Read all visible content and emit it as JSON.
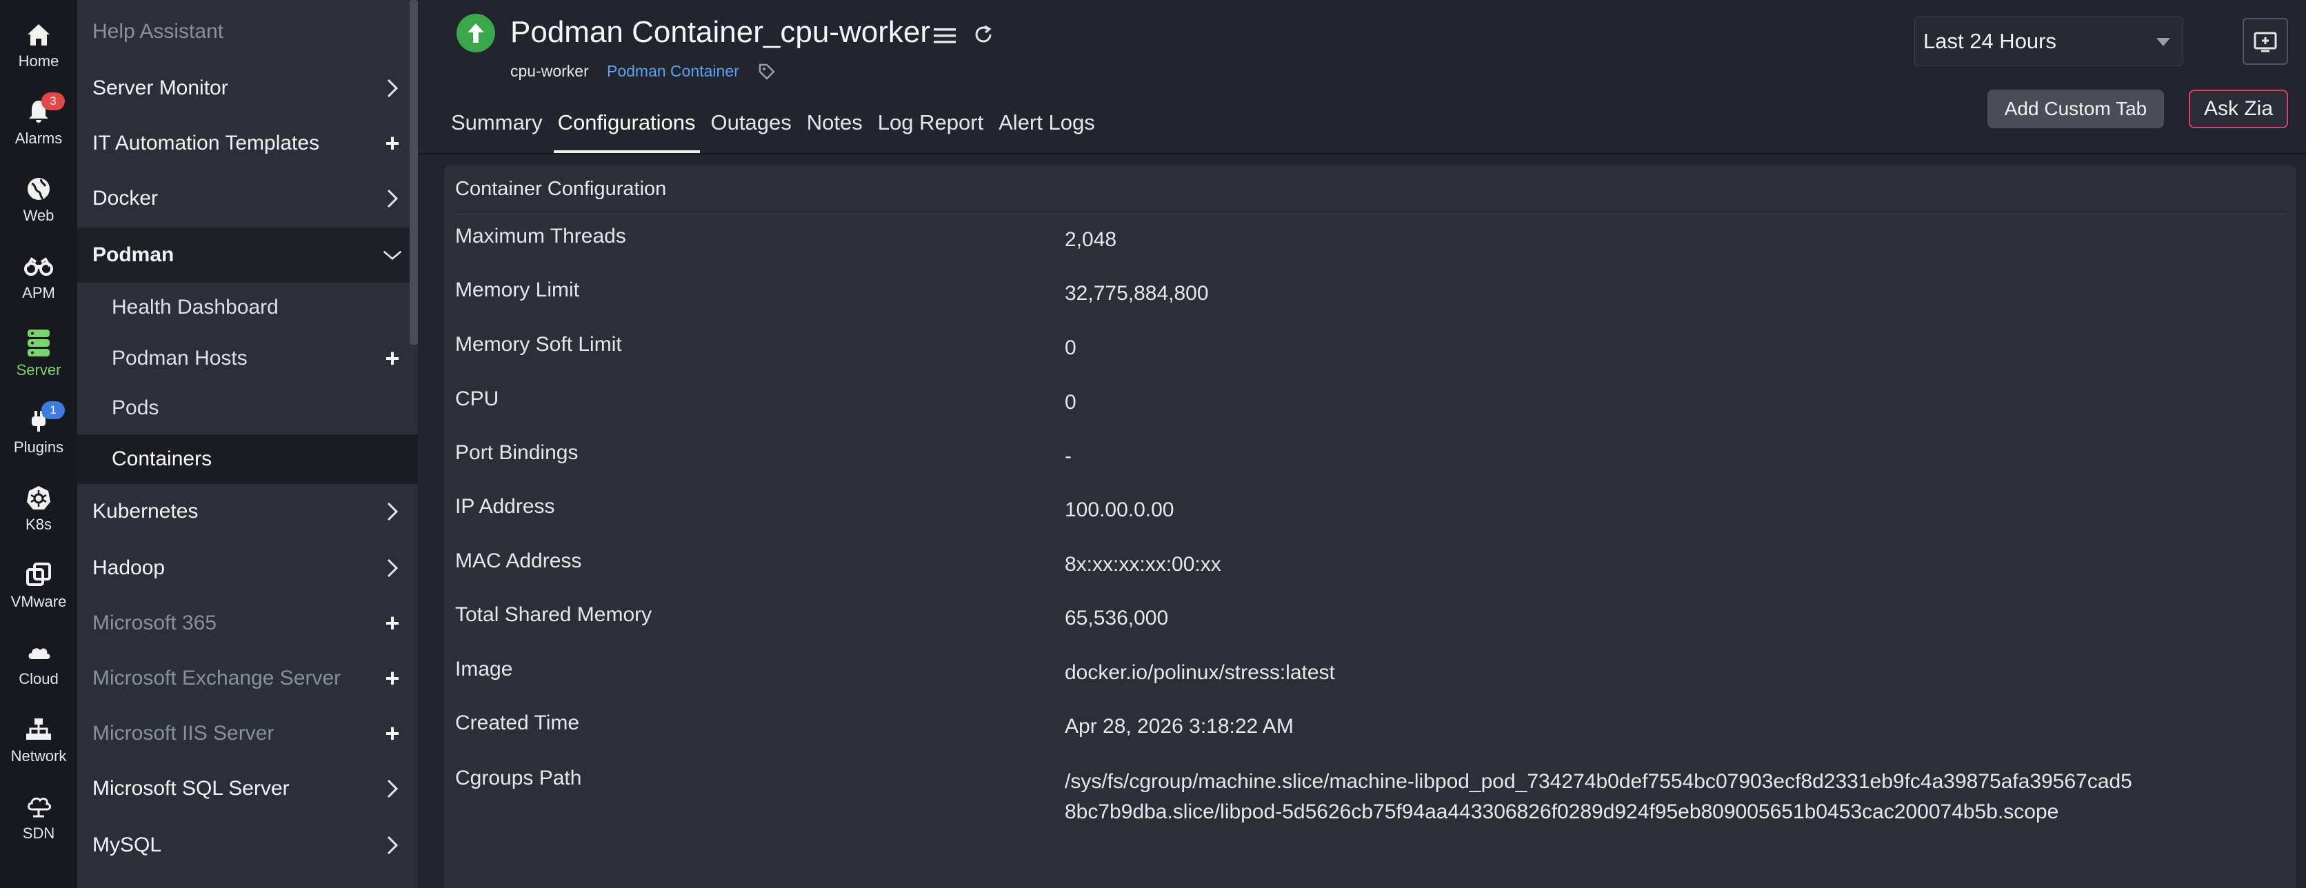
{
  "rail": [
    {
      "label": "Home",
      "icon": "home-icon"
    },
    {
      "label": "Alarms",
      "icon": "bell-icon",
      "badge": "3"
    },
    {
      "label": "Web",
      "icon": "globe-icon"
    },
    {
      "label": "APM",
      "icon": "binoculars-icon"
    },
    {
      "label": "Server",
      "icon": "server-icon"
    },
    {
      "label": "Plugins",
      "icon": "plug-icon",
      "badge": "1"
    },
    {
      "label": "K8s",
      "icon": "k8s-icon"
    },
    {
      "label": "VMware",
      "icon": "vmware-icon"
    },
    {
      "label": "Cloud",
      "icon": "cloud-icon"
    },
    {
      "label": "Network",
      "icon": "network-icon"
    },
    {
      "label": "SDN",
      "icon": "sdn-icon"
    }
  ],
  "nav": {
    "items": [
      {
        "label": "Help Assistant",
        "control": "none",
        "dim": true
      },
      {
        "label": "Server Monitor",
        "control": "chevron"
      },
      {
        "label": "IT Automation Templates",
        "control": "plus"
      },
      {
        "label": "Docker",
        "control": "chevron"
      },
      {
        "label": "Podman",
        "control": "chevron-down"
      }
    ],
    "podman_sub": [
      {
        "label": "Health Dashboard"
      },
      {
        "label": "Podman Hosts",
        "control": "plus"
      },
      {
        "label": "Pods"
      },
      {
        "label": "Containers"
      }
    ],
    "items_after": [
      {
        "label": "Kubernetes",
        "control": "chevron"
      },
      {
        "label": "Hadoop",
        "control": "chevron"
      },
      {
        "label": "Microsoft 365",
        "control": "plus",
        "dim": true
      },
      {
        "label": "Microsoft Exchange Server",
        "control": "plus",
        "dim": true
      },
      {
        "label": "Microsoft IIS Server",
        "control": "plus",
        "dim": true
      },
      {
        "label": "Microsoft SQL Server",
        "control": "chevron"
      },
      {
        "label": "MySQL",
        "control": "chevron"
      }
    ]
  },
  "header": {
    "title": "Podman Container_cpu-worker",
    "subtitle_name": "cpu-worker",
    "subtitle_type": "Podman Container",
    "time_range": "Last 24 Hours",
    "add_custom_tab": "Add Custom Tab",
    "ask_zia": "Ask Zia",
    "status_color": "#3aa64a"
  },
  "tabs": [
    "Summary",
    "Configurations",
    "Outages",
    "Notes",
    "Log Report",
    "Alert Logs"
  ],
  "active_tab": "Configurations",
  "config": {
    "title": "Container Configuration",
    "rows": [
      {
        "key": "Maximum Threads",
        "value": "2,048"
      },
      {
        "key": "Memory Limit",
        "value": "32,775,884,800"
      },
      {
        "key": "Memory Soft Limit",
        "value": "0"
      },
      {
        "key": "CPU",
        "value": "0"
      },
      {
        "key": "Port Bindings",
        "value": "-"
      },
      {
        "key": "IP Address",
        "value": "100.00.0.00"
      },
      {
        "key": "MAC Address",
        "value": "8x:xx:xx:xx:00:xx"
      },
      {
        "key": "Total Shared Memory",
        "value": "65,536,000"
      },
      {
        "key": "Image",
        "value": "docker.io/polinux/stress:latest"
      },
      {
        "key": "Created Time",
        "value": "Apr 28, 2026 3:18:22 AM"
      },
      {
        "key": "Cgroups Path",
        "value": "/sys/fs/cgroup/machine.slice/machine-libpod_pod_734274b0def7554bc07903ecf8d2331eb9fc4a39875afa39567cad58bc7b9dba.slice/libpod-5d5626cb75f94aa443306826f0289d924f95eb809005651b0453cac200074b5b.scope"
      }
    ]
  }
}
